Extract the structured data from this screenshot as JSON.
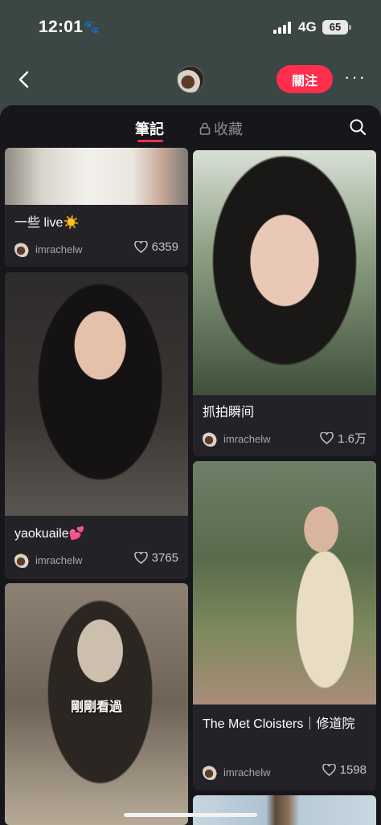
{
  "status": {
    "time": "12:01",
    "network": "4G",
    "battery": "65"
  },
  "nav": {
    "follow_label": "關注",
    "more_label": "···"
  },
  "tabs": {
    "notes": "筆記",
    "favorites": "收藏"
  },
  "cards": [
    {
      "title": "一些 live☀️",
      "author": "imrachelw",
      "likes": "6359"
    },
    {
      "title": "抓拍瞬间",
      "author": "imrachelw",
      "likes": "1.6万"
    },
    {
      "title": "yaokuaile💕",
      "author": "imrachelw",
      "likes": "3765"
    },
    {
      "title": "The Met Cloisters｜修道院",
      "author": "imrachelw",
      "likes": "1598"
    },
    {
      "overlay": "剛剛看過"
    }
  ],
  "colors": {
    "accent": "#ff2e4d",
    "background": "#17171b",
    "card": "#222227",
    "header": "#3b4744"
  }
}
